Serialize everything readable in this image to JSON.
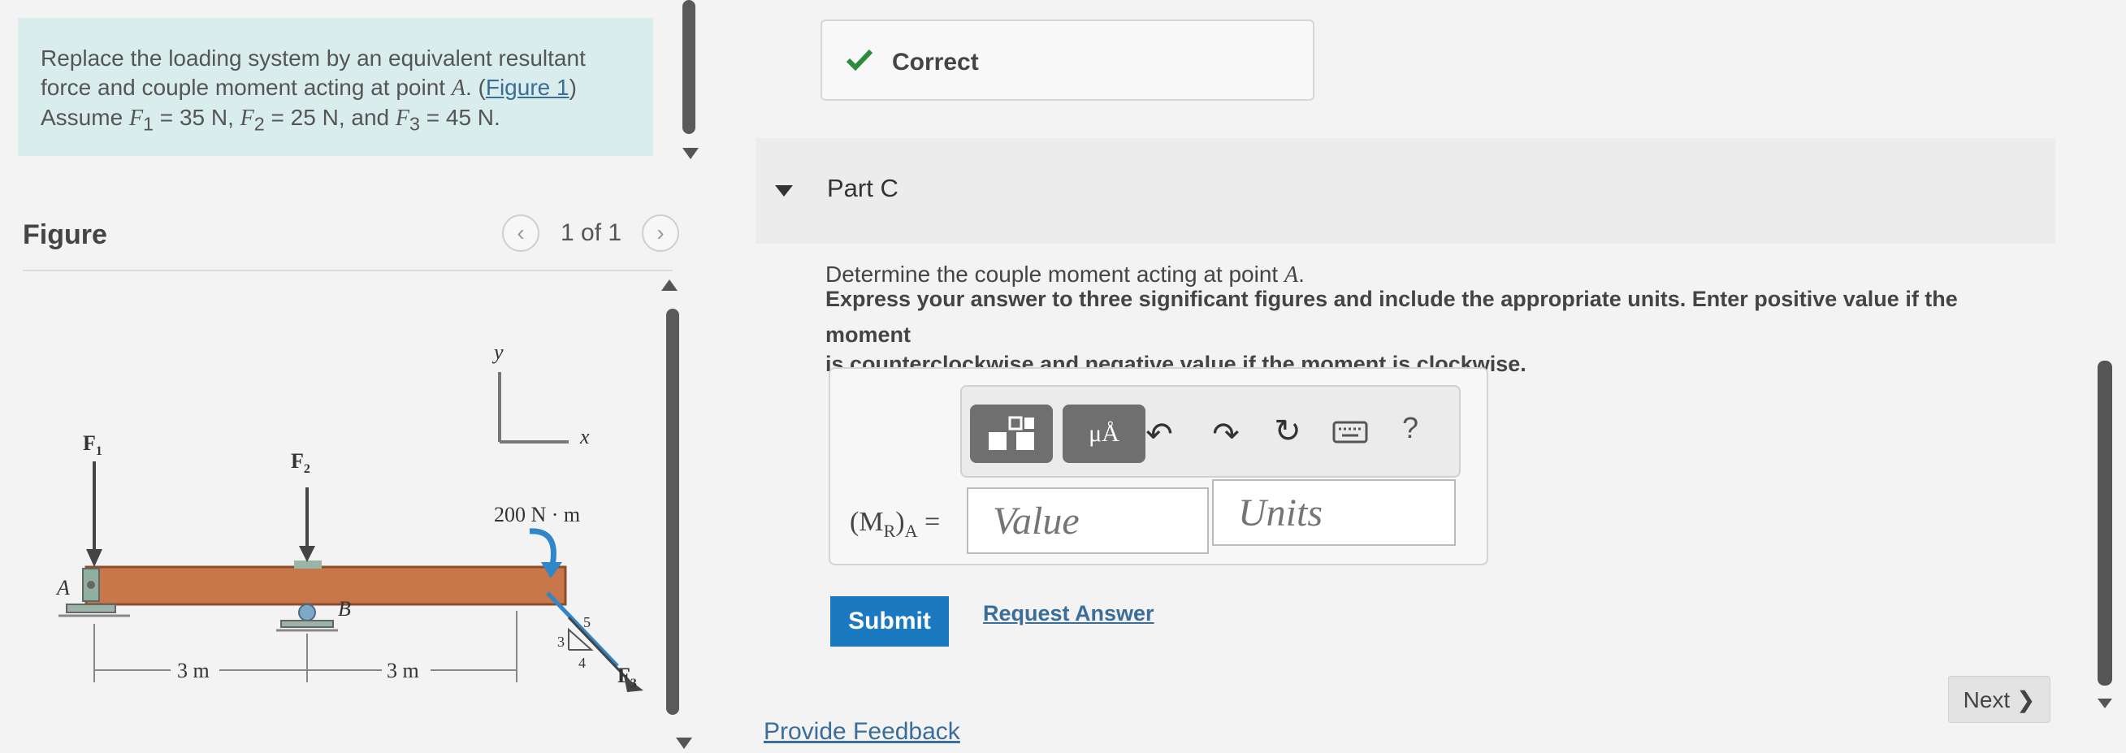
{
  "problem": {
    "line1": "Replace the loading system by an equivalent resultant",
    "line2_prefix": "force and couple moment acting at point ",
    "point": "A",
    "line2_mid": ". (",
    "figure_link": "Figure 1",
    "line2_end": ")",
    "line3_assume": "Assume ",
    "f1_sym": "F",
    "f1_sub": "1",
    "f1_val": " = 35 N",
    "sep1": ", ",
    "f2_sym": "F",
    "f2_sub": "2",
    "f2_val": " = 25 N",
    "sep2": ", and ",
    "f3_sym": "F",
    "f3_sub": "3",
    "f3_val": " = 45 N",
    "end": "."
  },
  "figure": {
    "title": "Figure",
    "counter": "1 of 1",
    "prev_icon": "chevron-left-icon",
    "next_icon": "chevron-right-icon",
    "labels": {
      "f1": "F",
      "f1_sub": "1",
      "f2": "F",
      "f2_sub": "2",
      "f3": "F",
      "f3_sub": "3",
      "point_a": "A",
      "point_b": "B",
      "axis_y": "y",
      "axis_x": "x",
      "moment": "200 N · m",
      "dim1": "3 m",
      "dim2": "3 m",
      "slope_3": "3",
      "slope_4": "4",
      "slope_5": "5"
    }
  },
  "status": {
    "icon": "checkmark-icon",
    "label": "Correct",
    "color": "#2e8b3d"
  },
  "part": {
    "toggle_icon": "caret-down-icon",
    "label": "Part C",
    "question_prefix": "Determine the couple moment acting at point ",
    "question_point": "A",
    "question_end": ".",
    "instructions_line1": "Express your answer to three significant figures and include the appropriate units. Enter positive value if the moment",
    "instructions_line2": "is counterclockwise and negative value if the moment is clockwise."
  },
  "toolbar": {
    "templates_icon": "templates-icon",
    "units_label": "μÅ",
    "undo_icon": "undo-icon",
    "redo_icon": "redo-icon",
    "reset_icon": "reset-icon",
    "keyboard_icon": "keyboard-icon",
    "help_label": "?"
  },
  "answer": {
    "label_open": "(M",
    "label_sub": "R",
    "label_close": ")",
    "label_sub2": "A",
    "label_eq": " =",
    "value_placeholder": "Value",
    "units_placeholder": "Units"
  },
  "actions": {
    "submit": "Submit",
    "request_answer": "Request Answer",
    "provide_feedback": "Provide Feedback",
    "next": "Next ❯",
    "accent": "#1b79c0"
  }
}
